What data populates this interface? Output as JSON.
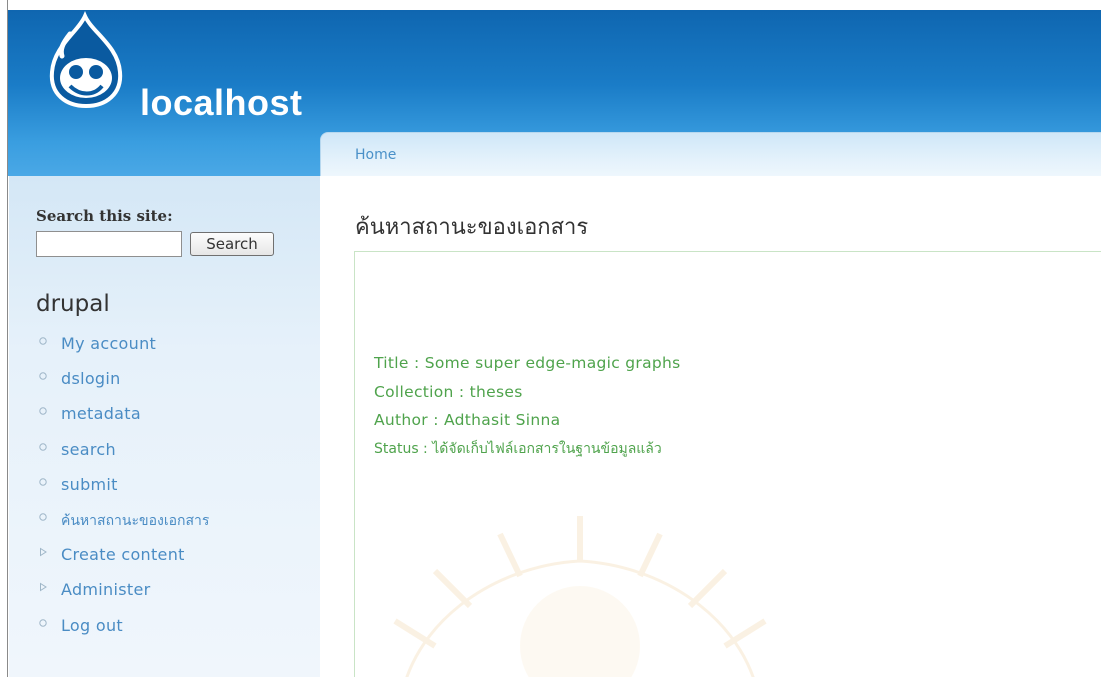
{
  "site": {
    "name": "localhost"
  },
  "breadcrumb": {
    "home": "Home"
  },
  "search": {
    "label": "Search this site:",
    "value": "",
    "button": "Search"
  },
  "nav": {
    "title": "drupal",
    "items": [
      {
        "label": "My account",
        "bullet": "circle"
      },
      {
        "label": "dslogin",
        "bullet": "circle"
      },
      {
        "label": "metadata",
        "bullet": "circle"
      },
      {
        "label": "search",
        "bullet": "circle"
      },
      {
        "label": "submit",
        "bullet": "circle"
      },
      {
        "label": "ค้นหาสถานะของเอกสาร",
        "bullet": "circle"
      },
      {
        "label": "Create content",
        "bullet": "triangle"
      },
      {
        "label": "Administer",
        "bullet": "triangle"
      },
      {
        "label": "Log out",
        "bullet": "circle"
      }
    ]
  },
  "main": {
    "title": "ค้นหาสถานะของเอกสาร",
    "record": {
      "title": "Title : Some super edge-magic graphs",
      "collection": "Collection : theses",
      "author": "Author : Adthasit Sinna",
      "status": "Status : ได้จัดเก็บไฟล์เอกสารในฐานข้อมูลแล้ว"
    }
  },
  "colors": {
    "header_blue": "#1a7cc7",
    "link_blue": "#4a8cc4",
    "record_green": "#4fa34c",
    "text_dark": "#333333"
  }
}
